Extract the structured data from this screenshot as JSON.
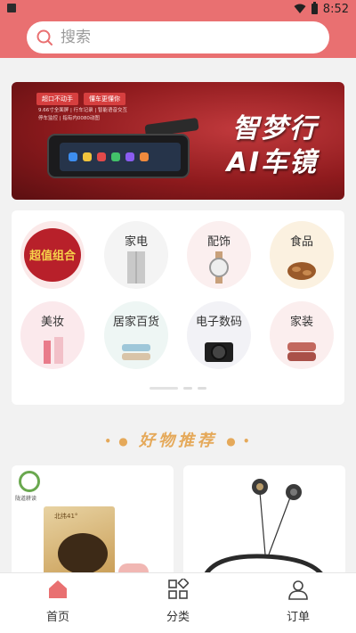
{
  "status": {
    "time": "8:52"
  },
  "search": {
    "placeholder": "搜索"
  },
  "banner": {
    "tags": [
      "超口不动手",
      "懂车更懂你"
    ],
    "features": [
      "9.66寸全面屏 | 行车记录 | 智能语音交互",
      "停车监控 | 指有内0080动图"
    ],
    "title_line1": "智梦行",
    "title_line2": "AI车镜"
  },
  "categories": [
    {
      "label": "超值组合",
      "icon": "gift-bundle-icon"
    },
    {
      "label": "家电",
      "icon": "fridge-icon"
    },
    {
      "label": "配饰",
      "icon": "watch-icon"
    },
    {
      "label": "食品",
      "icon": "nuts-icon"
    },
    {
      "label": "美妆",
      "icon": "lipstick-icon"
    },
    {
      "label": "居家百货",
      "icon": "towel-icon"
    },
    {
      "label": "电子数码",
      "icon": "camera-icon"
    },
    {
      "label": "家装",
      "icon": "blanket-icon"
    }
  ],
  "section": {
    "title": "好物推荐"
  },
  "products": [
    {
      "brand": "陇道耕读",
      "box_text": "北纬41°"
    },
    {
      "brand": "",
      "box_text": ""
    }
  ],
  "tabs": [
    {
      "label": "首页",
      "icon": "home-icon",
      "active": true
    },
    {
      "label": "分类",
      "icon": "grid-icon",
      "active": false
    },
    {
      "label": "订单",
      "icon": "user-icon",
      "active": false
    }
  ],
  "colors": {
    "accent": "#e97071",
    "section_title": "#e5a95a",
    "active_tab": "#e97071"
  }
}
